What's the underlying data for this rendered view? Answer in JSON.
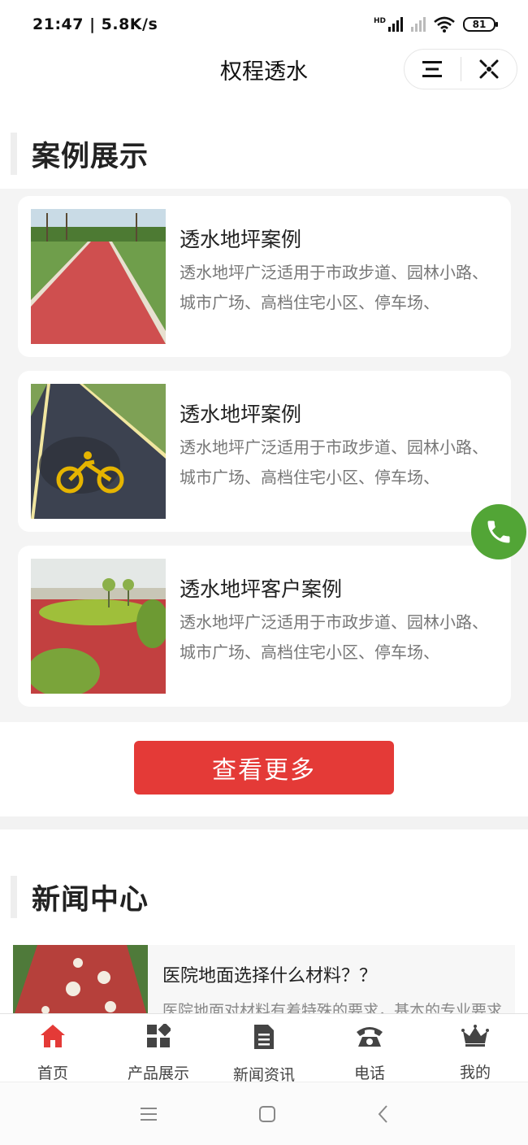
{
  "status_bar": {
    "time_speed": "21:47 | 5.8K/s",
    "network_badge": "HD",
    "battery": "81"
  },
  "header": {
    "title": "权程透水",
    "menu_icon": "hamburger-icon",
    "close_icon": "miniprogram-close-icon"
  },
  "cases_section": {
    "heading": "案例展示",
    "items": [
      {
        "title": "透水地坪案例",
        "description": "透水地坪广泛适用于市政步道、园林小路、城市广场、高档住宅小区、停车场、",
        "image": "red-park-path-photo"
      },
      {
        "title": "透水地坪案例",
        "description": "透水地坪广泛适用于市政步道、园林小路、城市广场、高档住宅小区、停车场、",
        "image": "bike-lane-photo"
      },
      {
        "title": "透水地坪客户案例",
        "description": "透水地坪广泛适用于市政步道、园林小路、城市广场、高档住宅小区、停车场、",
        "image": "lakeside-red-path-photo"
      }
    ],
    "more_button": "查看更多"
  },
  "news_section": {
    "heading": "新闻中心",
    "items": [
      {
        "title": "医院地面选择什么材料？？",
        "description": "医院地面对材料有着特殊的要求，基本的专业要求",
        "image": "flower-pattern-path-photo"
      }
    ]
  },
  "tabbar": {
    "items": [
      {
        "label": "首页",
        "icon": "home-icon",
        "active": true
      },
      {
        "label": "产品展示",
        "icon": "grid-icon",
        "active": false
      },
      {
        "label": "新闻资讯",
        "icon": "document-icon",
        "active": false
      },
      {
        "label": "电话",
        "icon": "telephone-icon",
        "active": false
      },
      {
        "label": "我的",
        "icon": "crown-icon",
        "active": false
      }
    ]
  },
  "system_nav": {
    "menu": "menu-icon",
    "home": "home-square-icon",
    "back": "back-chevron-icon"
  },
  "colors": {
    "accent_red": "#e43a37",
    "call_green": "#52a536",
    "section_bg": "#f4f4f4"
  }
}
